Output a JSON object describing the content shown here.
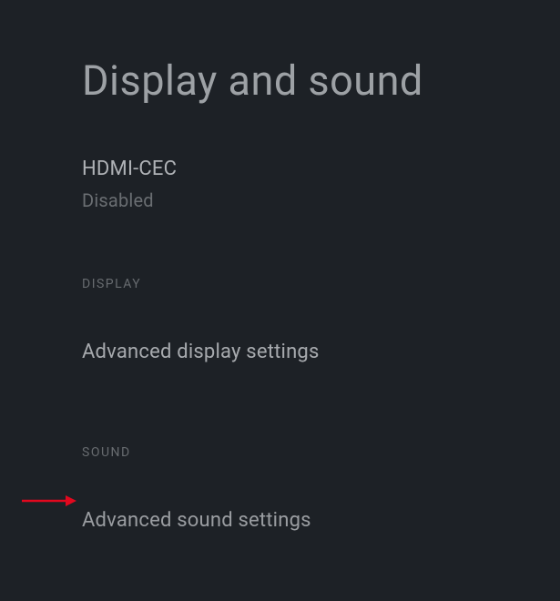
{
  "header": {
    "title": "Display and sound"
  },
  "items": {
    "hdmi_cec": {
      "label": "HDMI-CEC",
      "value": "Disabled"
    }
  },
  "sections": {
    "display": {
      "header": "DISPLAY",
      "link": "Advanced display settings"
    },
    "sound": {
      "header": "SOUND",
      "link": "Advanced sound settings"
    }
  },
  "annotation": {
    "arrow_color": "#e2081e"
  }
}
